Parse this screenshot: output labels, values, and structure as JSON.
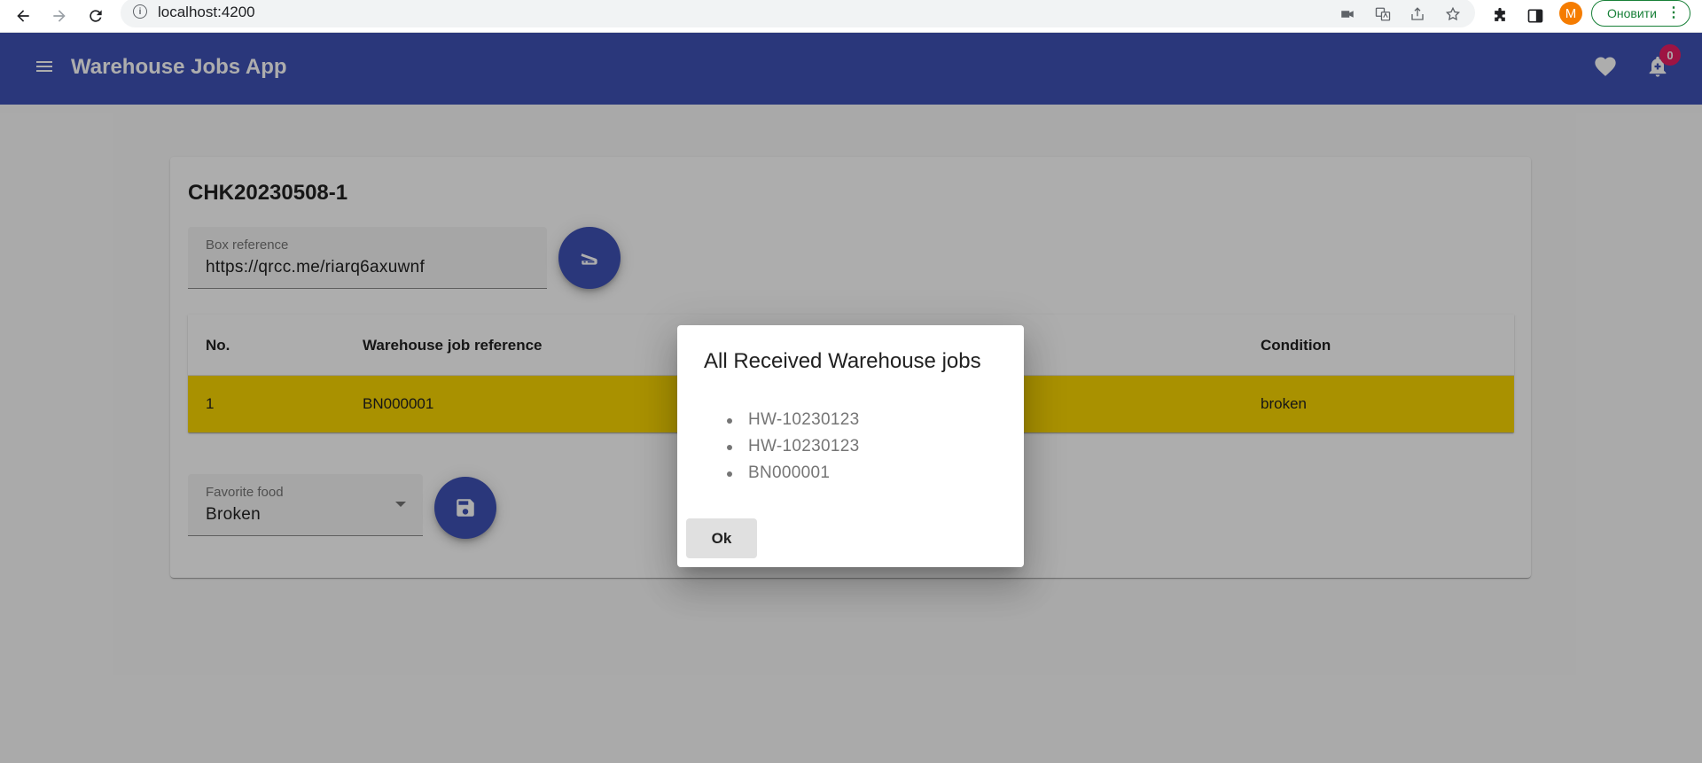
{
  "browser": {
    "url": "localhost:4200",
    "profile_initial": "M",
    "update_label": "Оновити"
  },
  "app": {
    "title": "Warehouse Jobs App",
    "notification_count": "0",
    "brand_color": "#3f51b5"
  },
  "card": {
    "title": "CHK20230508-1",
    "box_reference": {
      "label": "Box reference",
      "value": "https://qrcc.me/riarq6axuwnf"
    },
    "table": {
      "headers": [
        "No.",
        "Warehouse job reference",
        "Condition"
      ],
      "rows": [
        [
          "1",
          "BN000001",
          "broken"
        ]
      ],
      "highlight_color": "#f9d600"
    },
    "condition_select": {
      "label": "Favorite food",
      "value": "Broken"
    }
  },
  "dialog": {
    "title": "All Received Warehouse jobs",
    "items": [
      "HW-10230123",
      "HW-10230123",
      "BN000001"
    ],
    "ok_label": "Ok"
  }
}
